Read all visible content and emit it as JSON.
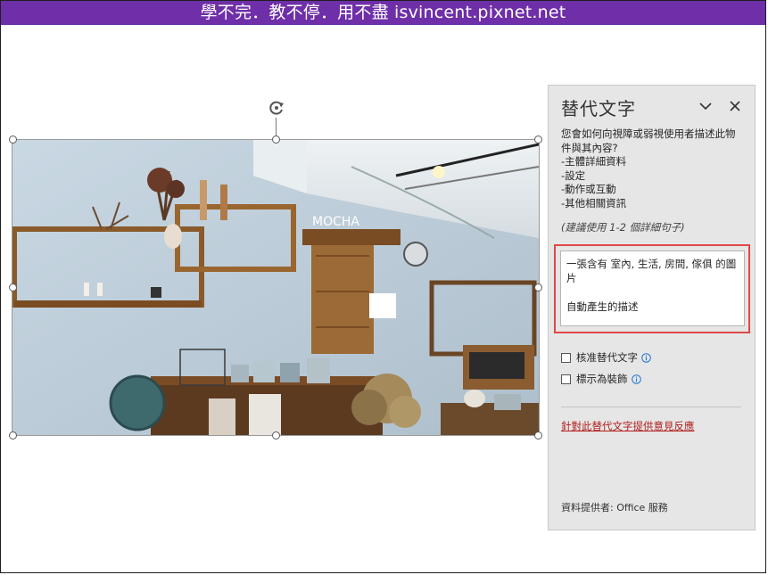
{
  "banner": {
    "text": "學不完．教不停．用不盡 isvincent.pixnet.net",
    "color": "#6e2fa8"
  },
  "picture": {
    "subject": "cafe interior photo",
    "icon": "rotate-icon"
  },
  "pane": {
    "title": "替代文字",
    "collapse_icon": "chevron-down-icon",
    "close_icon": "close-icon",
    "question": "您會如何向視障或弱視使用者描述此物件與其內容?",
    "bullets": [
      "-主體詳細資料",
      "-設定",
      "-動作或互動",
      "-其他相關資訊"
    ],
    "hint": "(建議使用 1-2 個詳細句子)",
    "alt_text_line1": "一張含有 室內, 生活, 房間, 傢俱 的圖片",
    "alt_text_line2": "自動產生的描述",
    "highlight_color": "#e04848",
    "approve_label": "核准替代文字",
    "decorative_label": "標示為裝飾",
    "feedback_link": "針對此替代文字提供意見反應",
    "provider": "資料提供者: Office 服務"
  }
}
